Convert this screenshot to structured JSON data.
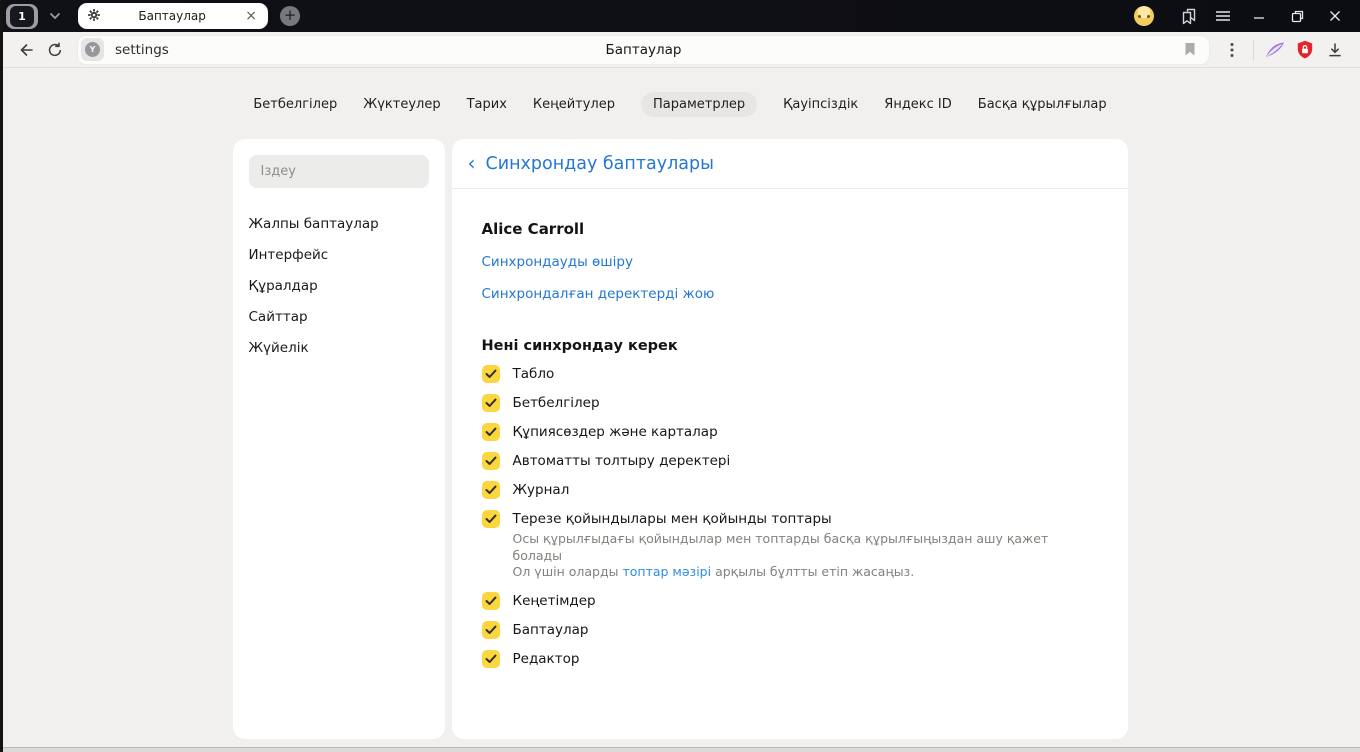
{
  "titlebar": {
    "tab_count": "1",
    "tab_title": "Баптаулар",
    "close_label": "×",
    "new_tab_label": "+"
  },
  "toolbar": {
    "address": "settings",
    "page_title": "Баптаулар"
  },
  "nav_tabs": {
    "items": [
      {
        "label": "Бетбелгілер",
        "active": false
      },
      {
        "label": "Жүктеулер",
        "active": false
      },
      {
        "label": "Тарих",
        "active": false
      },
      {
        "label": "Кеңейтулер",
        "active": false
      },
      {
        "label": "Параметрлер",
        "active": true
      },
      {
        "label": "Қауіпсіздік",
        "active": false
      },
      {
        "label": "Яндекс ID",
        "active": false
      },
      {
        "label": "Басқа құрылғылар",
        "active": false
      }
    ]
  },
  "sidebar": {
    "search_placeholder": "Іздеу",
    "items": [
      "Жалпы баптаулар",
      "Интерфейс",
      "Құралдар",
      "Сайттар",
      "Жүйелік"
    ]
  },
  "main": {
    "back_icon": "‹",
    "heading": "Синхрондау баптаулары",
    "account_name": "Alice Carroll",
    "links": {
      "disable_sync": "Синхрондауды өшіру",
      "delete_synced": "Синхрондалған деректерді жою"
    },
    "section_title": "Нені синхрондау керек",
    "sync_items": [
      {
        "label": "Табло",
        "checked": true
      },
      {
        "label": "Бетбелгілер",
        "checked": true
      },
      {
        "label": "Құпиясөздер және карталар",
        "checked": true
      },
      {
        "label": "Автоматты толтыру деректері",
        "checked": true
      },
      {
        "label": "Журнал",
        "checked": true
      },
      {
        "label": "Терезе қойындылары мен қойынды топтары",
        "checked": true,
        "description": {
          "line1": "Осы құрылғыдағы қойындылар мен топтарды басқа құрылғыңыздан ашу қажет болады",
          "line2_before": "Ол үшін оларды ",
          "line2_link": "топтар мәзірі",
          "line2_after": " арқылы бұлтты етіп жасаңыз."
        }
      },
      {
        "label": "Кеңетімдер",
        "checked": true
      },
      {
        "label": "Баптаулар",
        "checked": true
      },
      {
        "label": "Редактор",
        "checked": true
      }
    ]
  },
  "colors": {
    "accent_blue": "#2577d4",
    "checkbox_yellow": "#fbd63f",
    "shield_red": "#e3242b",
    "feather_purple": "#a478dd",
    "titlebar_dark": "#101116",
    "page_background": "#f1f0ee"
  }
}
